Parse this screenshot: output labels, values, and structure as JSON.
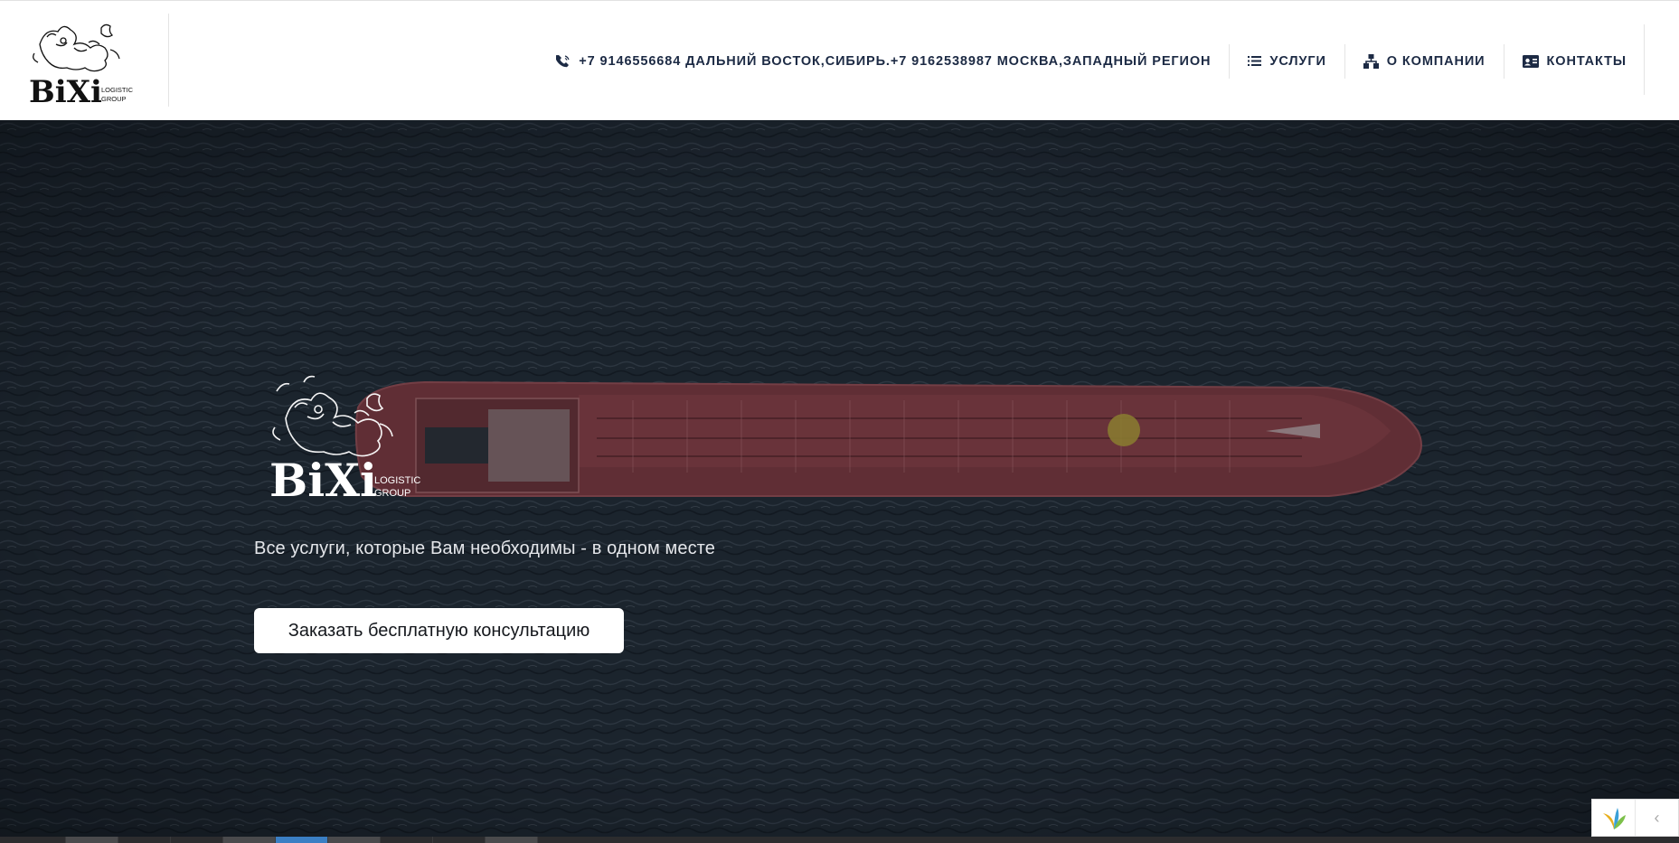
{
  "logo": {
    "main": "BiXi",
    "sub1": "LOGISTIC",
    "sub2": "GROUP"
  },
  "nav": {
    "phones": {
      "label": "+7 9146556684 ДАЛЬНИЙ ВОСТОК,СИБИРЬ.+7 9162538987 МОСКВА,ЗАПАДНЫЙ РЕГИОН",
      "icon": "phone-icon"
    },
    "services": {
      "label": "УСЛУГИ",
      "icon": "list-icon"
    },
    "about": {
      "label": "О КОМПАНИИ",
      "icon": "sitemap-icon"
    },
    "contacts": {
      "label": "КОНТАКТЫ",
      "icon": "id-card-icon"
    }
  },
  "hero": {
    "tagline": "Все услуги, которые Вам необходимы - в одном месте",
    "cta_label": "Заказать бесплатную консультацию"
  },
  "widget": {
    "arrow": "‹",
    "icon": "three-leaf-logo-icon"
  },
  "colors": {
    "nav_text": "#1c2a44",
    "sea": "#1e2833",
    "ship_deck": "#8a3a40",
    "cta_bg": "#ffffff"
  }
}
